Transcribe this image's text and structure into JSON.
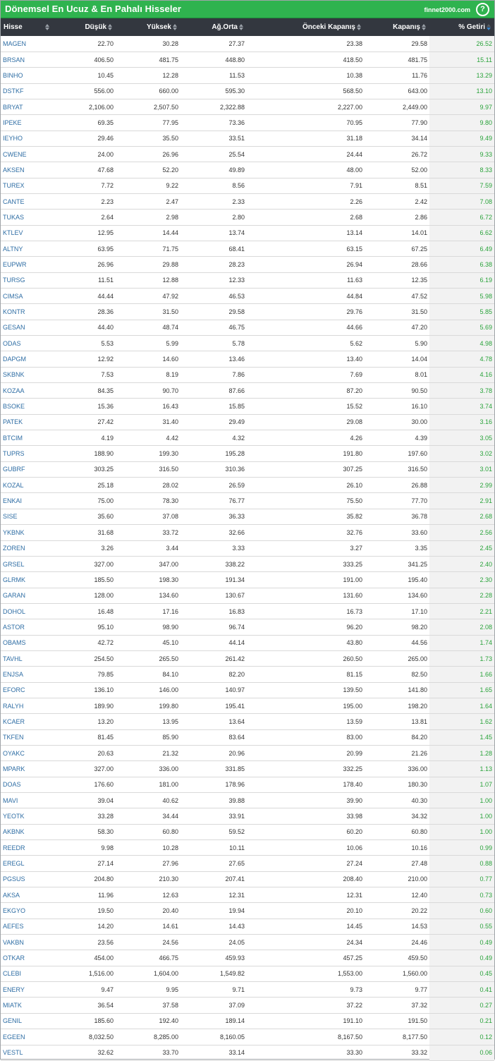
{
  "header": {
    "title": "Dönemsel En Ucuz & En Pahalı Hisseler",
    "brand": "finnet2000.com",
    "help_icon": "?"
  },
  "columns": {
    "hisse": "Hisse",
    "dusuk": "Düşük",
    "yuksek": "Yüksek",
    "agorta": "Ağ.Orta",
    "onceki": "Önceki Kapanış",
    "kapanis": "Kapanış",
    "getiri": "% Getiri"
  },
  "colors": {
    "header_green": "#2fb34f",
    "table_header": "#33373f",
    "symbol_blue": "#2e6da4",
    "gain_green": "#2aa33b"
  },
  "rows": [
    [
      "MAGEN",
      "22.70",
      "30.28",
      "27.37",
      "23.38",
      "29.58",
      "26.52"
    ],
    [
      "BRSAN",
      "406.50",
      "481.75",
      "448.80",
      "418.50",
      "481.75",
      "15.11"
    ],
    [
      "BINHO",
      "10.45",
      "12.28",
      "11.53",
      "10.38",
      "11.76",
      "13.29"
    ],
    [
      "DSTKF",
      "556.00",
      "660.00",
      "595.30",
      "568.50",
      "643.00",
      "13.10"
    ],
    [
      "BRYAT",
      "2,106.00",
      "2,507.50",
      "2,322.88",
      "2,227.00",
      "2,449.00",
      "9.97"
    ],
    [
      "IPEKE",
      "69.35",
      "77.95",
      "73.36",
      "70.95",
      "77.90",
      "9.80"
    ],
    [
      "IEYHO",
      "29.46",
      "35.50",
      "33.51",
      "31.18",
      "34.14",
      "9.49"
    ],
    [
      "CWENE",
      "24.00",
      "26.96",
      "25.54",
      "24.44",
      "26.72",
      "9.33"
    ],
    [
      "AKSEN",
      "47.68",
      "52.20",
      "49.89",
      "48.00",
      "52.00",
      "8.33"
    ],
    [
      "TUREX",
      "7.72",
      "9.22",
      "8.56",
      "7.91",
      "8.51",
      "7.59"
    ],
    [
      "CANTE",
      "2.23",
      "2.47",
      "2.33",
      "2.26",
      "2.42",
      "7.08"
    ],
    [
      "TUKAS",
      "2.64",
      "2.98",
      "2.80",
      "2.68",
      "2.86",
      "6.72"
    ],
    [
      "KTLEV",
      "12.95",
      "14.44",
      "13.74",
      "13.14",
      "14.01",
      "6.62"
    ],
    [
      "ALTNY",
      "63.95",
      "71.75",
      "68.41",
      "63.15",
      "67.25",
      "6.49"
    ],
    [
      "EUPWR",
      "26.96",
      "29.88",
      "28.23",
      "26.94",
      "28.66",
      "6.38"
    ],
    [
      "TURSG",
      "11.51",
      "12.88",
      "12.33",
      "11.63",
      "12.35",
      "6.19"
    ],
    [
      "CIMSA",
      "44.44",
      "47.92",
      "46.53",
      "44.84",
      "47.52",
      "5.98"
    ],
    [
      "KONTR",
      "28.36",
      "31.50",
      "29.58",
      "29.76",
      "31.50",
      "5.85"
    ],
    [
      "GESAN",
      "44.40",
      "48.74",
      "46.75",
      "44.66",
      "47.20",
      "5.69"
    ],
    [
      "ODAS",
      "5.53",
      "5.99",
      "5.78",
      "5.62",
      "5.90",
      "4.98"
    ],
    [
      "DAPGM",
      "12.92",
      "14.60",
      "13.46",
      "13.40",
      "14.04",
      "4.78"
    ],
    [
      "SKBNK",
      "7.53",
      "8.19",
      "7.86",
      "7.69",
      "8.01",
      "4.16"
    ],
    [
      "KOZAA",
      "84.35",
      "90.70",
      "87.66",
      "87.20",
      "90.50",
      "3.78"
    ],
    [
      "BSOKE",
      "15.36",
      "16.43",
      "15.85",
      "15.52",
      "16.10",
      "3.74"
    ],
    [
      "PATEK",
      "27.42",
      "31.40",
      "29.49",
      "29.08",
      "30.00",
      "3.16"
    ],
    [
      "BTCIM",
      "4.19",
      "4.42",
      "4.32",
      "4.26",
      "4.39",
      "3.05"
    ],
    [
      "TUPRS",
      "188.90",
      "199.30",
      "195.28",
      "191.80",
      "197.60",
      "3.02"
    ],
    [
      "GUBRF",
      "303.25",
      "316.50",
      "310.36",
      "307.25",
      "316.50",
      "3.01"
    ],
    [
      "KOZAL",
      "25.18",
      "28.02",
      "26.59",
      "26.10",
      "26.88",
      "2.99"
    ],
    [
      "ENKAI",
      "75.00",
      "78.30",
      "76.77",
      "75.50",
      "77.70",
      "2.91"
    ],
    [
      "SISE",
      "35.60",
      "37.08",
      "36.33",
      "35.82",
      "36.78",
      "2.68"
    ],
    [
      "YKBNK",
      "31.68",
      "33.72",
      "32.66",
      "32.76",
      "33.60",
      "2.56"
    ],
    [
      "ZOREN",
      "3.26",
      "3.44",
      "3.33",
      "3.27",
      "3.35",
      "2.45"
    ],
    [
      "GRSEL",
      "327.00",
      "347.00",
      "338.22",
      "333.25",
      "341.25",
      "2.40"
    ],
    [
      "GLRMK",
      "185.50",
      "198.30",
      "191.34",
      "191.00",
      "195.40",
      "2.30"
    ],
    [
      "GARAN",
      "128.00",
      "134.60",
      "130.67",
      "131.60",
      "134.60",
      "2.28"
    ],
    [
      "DOHOL",
      "16.48",
      "17.16",
      "16.83",
      "16.73",
      "17.10",
      "2.21"
    ],
    [
      "ASTOR",
      "95.10",
      "98.90",
      "96.74",
      "96.20",
      "98.20",
      "2.08"
    ],
    [
      "OBAMS",
      "42.72",
      "45.10",
      "44.14",
      "43.80",
      "44.56",
      "1.74"
    ],
    [
      "TAVHL",
      "254.50",
      "265.50",
      "261.42",
      "260.50",
      "265.00",
      "1.73"
    ],
    [
      "ENJSA",
      "79.85",
      "84.10",
      "82.20",
      "81.15",
      "82.50",
      "1.66"
    ],
    [
      "EFORC",
      "136.10",
      "146.00",
      "140.97",
      "139.50",
      "141.80",
      "1.65"
    ],
    [
      "RALYH",
      "189.90",
      "199.80",
      "195.41",
      "195.00",
      "198.20",
      "1.64"
    ],
    [
      "KCAER",
      "13.20",
      "13.95",
      "13.64",
      "13.59",
      "13.81",
      "1.62"
    ],
    [
      "TKFEN",
      "81.45",
      "85.90",
      "83.64",
      "83.00",
      "84.20",
      "1.45"
    ],
    [
      "OYAKC",
      "20.63",
      "21.32",
      "20.96",
      "20.99",
      "21.26",
      "1.28"
    ],
    [
      "MPARK",
      "327.00",
      "336.00",
      "331.85",
      "332.25",
      "336.00",
      "1.13"
    ],
    [
      "DOAS",
      "176.60",
      "181.00",
      "178.96",
      "178.40",
      "180.30",
      "1.07"
    ],
    [
      "MAVI",
      "39.04",
      "40.62",
      "39.88",
      "39.90",
      "40.30",
      "1.00"
    ],
    [
      "YEOTK",
      "33.28",
      "34.44",
      "33.91",
      "33.98",
      "34.32",
      "1.00"
    ],
    [
      "AKBNK",
      "58.30",
      "60.80",
      "59.52",
      "60.20",
      "60.80",
      "1.00"
    ],
    [
      "REEDR",
      "9.98",
      "10.28",
      "10.11",
      "10.06",
      "10.16",
      "0.99"
    ],
    [
      "EREGL",
      "27.14",
      "27.96",
      "27.65",
      "27.24",
      "27.48",
      "0.88"
    ],
    [
      "PGSUS",
      "204.80",
      "210.30",
      "207.41",
      "208.40",
      "210.00",
      "0.77"
    ],
    [
      "AKSA",
      "11.96",
      "12.63",
      "12.31",
      "12.31",
      "12.40",
      "0.73"
    ],
    [
      "EKGYO",
      "19.50",
      "20.40",
      "19.94",
      "20.10",
      "20.22",
      "0.60"
    ],
    [
      "AEFES",
      "14.20",
      "14.61",
      "14.43",
      "14.45",
      "14.53",
      "0.55"
    ],
    [
      "VAKBN",
      "23.56",
      "24.56",
      "24.05",
      "24.34",
      "24.46",
      "0.49"
    ],
    [
      "OTKAR",
      "454.00",
      "466.75",
      "459.93",
      "457.25",
      "459.50",
      "0.49"
    ],
    [
      "CLEBI",
      "1,516.00",
      "1,604.00",
      "1,549.82",
      "1,553.00",
      "1,560.00",
      "0.45"
    ],
    [
      "ENERY",
      "9.47",
      "9.95",
      "9.71",
      "9.73",
      "9.77",
      "0.41"
    ],
    [
      "MIATK",
      "36.54",
      "37.58",
      "37.09",
      "37.22",
      "37.32",
      "0.27"
    ],
    [
      "GENIL",
      "185.60",
      "192.40",
      "189.14",
      "191.10",
      "191.50",
      "0.21"
    ],
    [
      "EGEEN",
      "8,032.50",
      "8,285.00",
      "8,160.05",
      "8,167.50",
      "8,177.50",
      "0.12"
    ],
    [
      "VESTL",
      "32.62",
      "33.70",
      "33.14",
      "33.30",
      "33.32",
      "0.06"
    ]
  ]
}
